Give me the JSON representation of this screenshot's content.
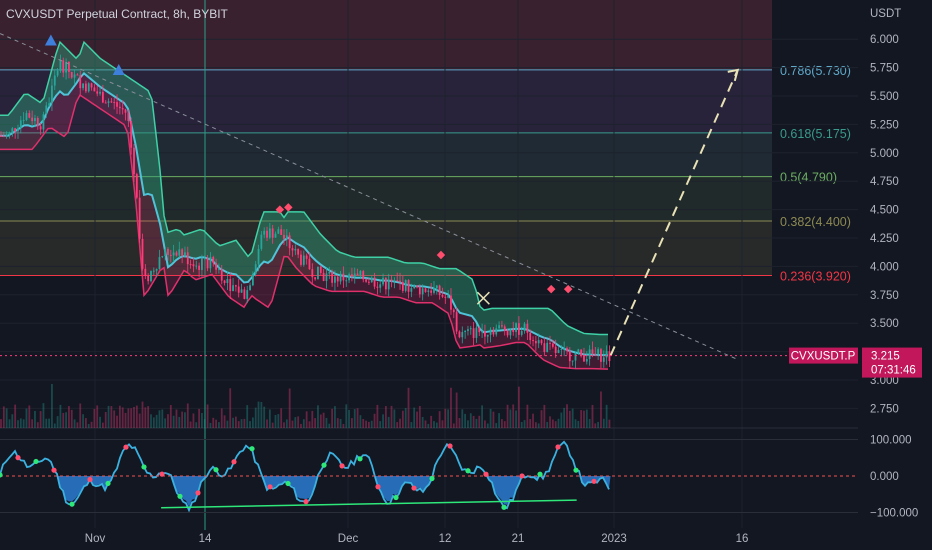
{
  "header": {
    "title": "CVXUSDT Perpetual Contract, 8h, BYBIT",
    "currency": "USDT"
  },
  "price_label": {
    "symbol": "CVXUSDT.P",
    "price": "3.215",
    "countdown": "07:31:46"
  },
  "colors": {
    "background": "#131722",
    "grid": "#1e222d",
    "axis_text": "#b2b5be",
    "up": "#26a69a",
    "down": "#ff3b7a",
    "band_green": "#2e9e78",
    "band_pink": "#e0306c",
    "fib_0786": "#5fa8c8",
    "fib_0618": "#3a9a8c",
    "fib_05": "#6cae62",
    "fib_0382": "#8d8a52",
    "fib_0236": "#f23645",
    "projection": "#e8e1b5",
    "osc_blue": "#2c7bd1",
    "osc_line": "#3bb1e0",
    "price_badge": "#c2185b"
  },
  "chart_data": [
    {
      "type": "candlestick",
      "title": "CVXUSDT Perpetual Contract, 8h, BYBIT",
      "y_unit": "USDT",
      "y_ticks": [
        2.75,
        3.0,
        3.25,
        3.5,
        3.75,
        4.0,
        4.25,
        4.5,
        4.75,
        5.0,
        5.25,
        5.5,
        5.75,
        6.0
      ],
      "ylim": [
        2.6,
        6.2
      ],
      "x_ticks": [
        "Nov",
        "14",
        "Dec",
        "12",
        "21",
        "2023",
        "16"
      ],
      "last_price": 3.215,
      "price_path": [
        [
          "Oct 25",
          5.15
        ],
        [
          "Oct 27",
          5.35
        ],
        [
          "Oct 29",
          5.25
        ],
        [
          "Oct 31",
          5.8
        ],
        [
          "Nov 2",
          5.65
        ],
        [
          "Nov 4",
          5.55
        ],
        [
          "Nov 6",
          5.45
        ],
        [
          "Nov 8",
          5.35
        ],
        [
          "Nov 9",
          4.7
        ],
        [
          "Nov 10",
          3.85
        ],
        [
          "Nov 12",
          4.1
        ],
        [
          "Nov 14",
          4.15
        ],
        [
          "Nov 16",
          4.0
        ],
        [
          "Nov 18",
          4.05
        ],
        [
          "Nov 20",
          3.85
        ],
        [
          "Nov 22",
          3.75
        ],
        [
          "Nov 24",
          4.3
        ],
        [
          "Nov 26",
          4.3
        ],
        [
          "Nov 28",
          4.1
        ],
        [
          "Nov 30",
          3.95
        ],
        [
          "Dec 2",
          3.9
        ],
        [
          "Dec 4",
          3.9
        ],
        [
          "Dec 6",
          3.9
        ],
        [
          "Dec 8",
          3.85
        ],
        [
          "Dec 10",
          3.85
        ],
        [
          "Dec 12",
          3.8
        ],
        [
          "Dec 14",
          3.8
        ],
        [
          "Dec 16",
          3.7
        ],
        [
          "Dec 17",
          3.4
        ],
        [
          "Dec 19",
          3.42
        ],
        [
          "Dec 21",
          3.45
        ],
        [
          "Dec 23",
          3.45
        ],
        [
          "Dec 25",
          3.45
        ],
        [
          "Dec 27",
          3.3
        ],
        [
          "Dec 29",
          3.23
        ],
        [
          "Dec 31",
          3.22
        ],
        [
          "Jan 2",
          3.22
        ],
        [
          "Jan 4",
          3.215
        ]
      ],
      "fibonacci_levels": [
        {
          "label": "0.786(5.730)",
          "level": 0.786,
          "price": 5.73
        },
        {
          "label": "0.618(5.175)",
          "level": 0.618,
          "price": 5.175
        },
        {
          "label": "0.5(4.790)",
          "level": 0.5,
          "price": 4.79
        },
        {
          "label": "0.382(4.400)",
          "level": 0.382,
          "price": 4.4
        },
        {
          "label": "0.236(3.920)",
          "level": 0.236,
          "price": 3.92
        }
      ],
      "projection": {
        "from": [
          "Jan 4",
          3.215
        ],
        "to": [
          "Jan 19",
          5.73
        ]
      },
      "trendline": {
        "from": [
          "Oct 24",
          6.05
        ],
        "to": [
          "Jan 19",
          3.18
        ]
      }
    },
    {
      "type": "line",
      "name": "oscillator",
      "y_ticks": [
        100,
        0,
        -100
      ],
      "y_tick_labels": [
        "100.000",
        "0.000",
        "−100.000"
      ],
      "ylim": [
        -115,
        120
      ]
    }
  ]
}
